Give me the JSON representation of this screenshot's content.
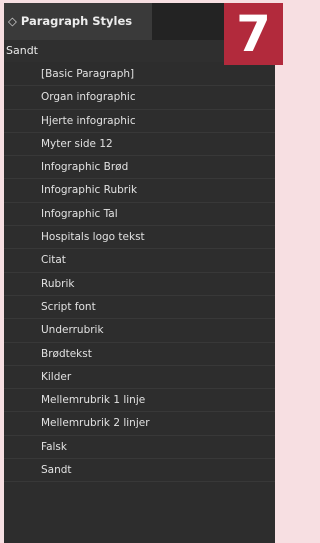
{
  "panel": {
    "tab_arrows": "◇",
    "tab_title": "Paragraph Styles",
    "group_label": "Sandt",
    "styles": [
      "[Basic Paragraph]",
      "Organ infographic",
      "Hjerte infographic",
      "Myter side 12",
      "Infographic Brød",
      "Infographic Rubrik",
      "Infographic Tal",
      "Hospitals logo tekst",
      "Citat",
      "Rubrik",
      "Script font",
      "Underrubrik",
      "Brødtekst",
      "Kilder",
      "Mellemrubrik 1 linje",
      "Mellemrubrik 2 linjer",
      "Falsk",
      "Sandt"
    ]
  },
  "badge": {
    "number": "7"
  },
  "colors": {
    "background": "#f7dfe2",
    "panel": "#2d2d2d",
    "tab_active": "#3a3a3a",
    "badge": "#b22a3c"
  }
}
